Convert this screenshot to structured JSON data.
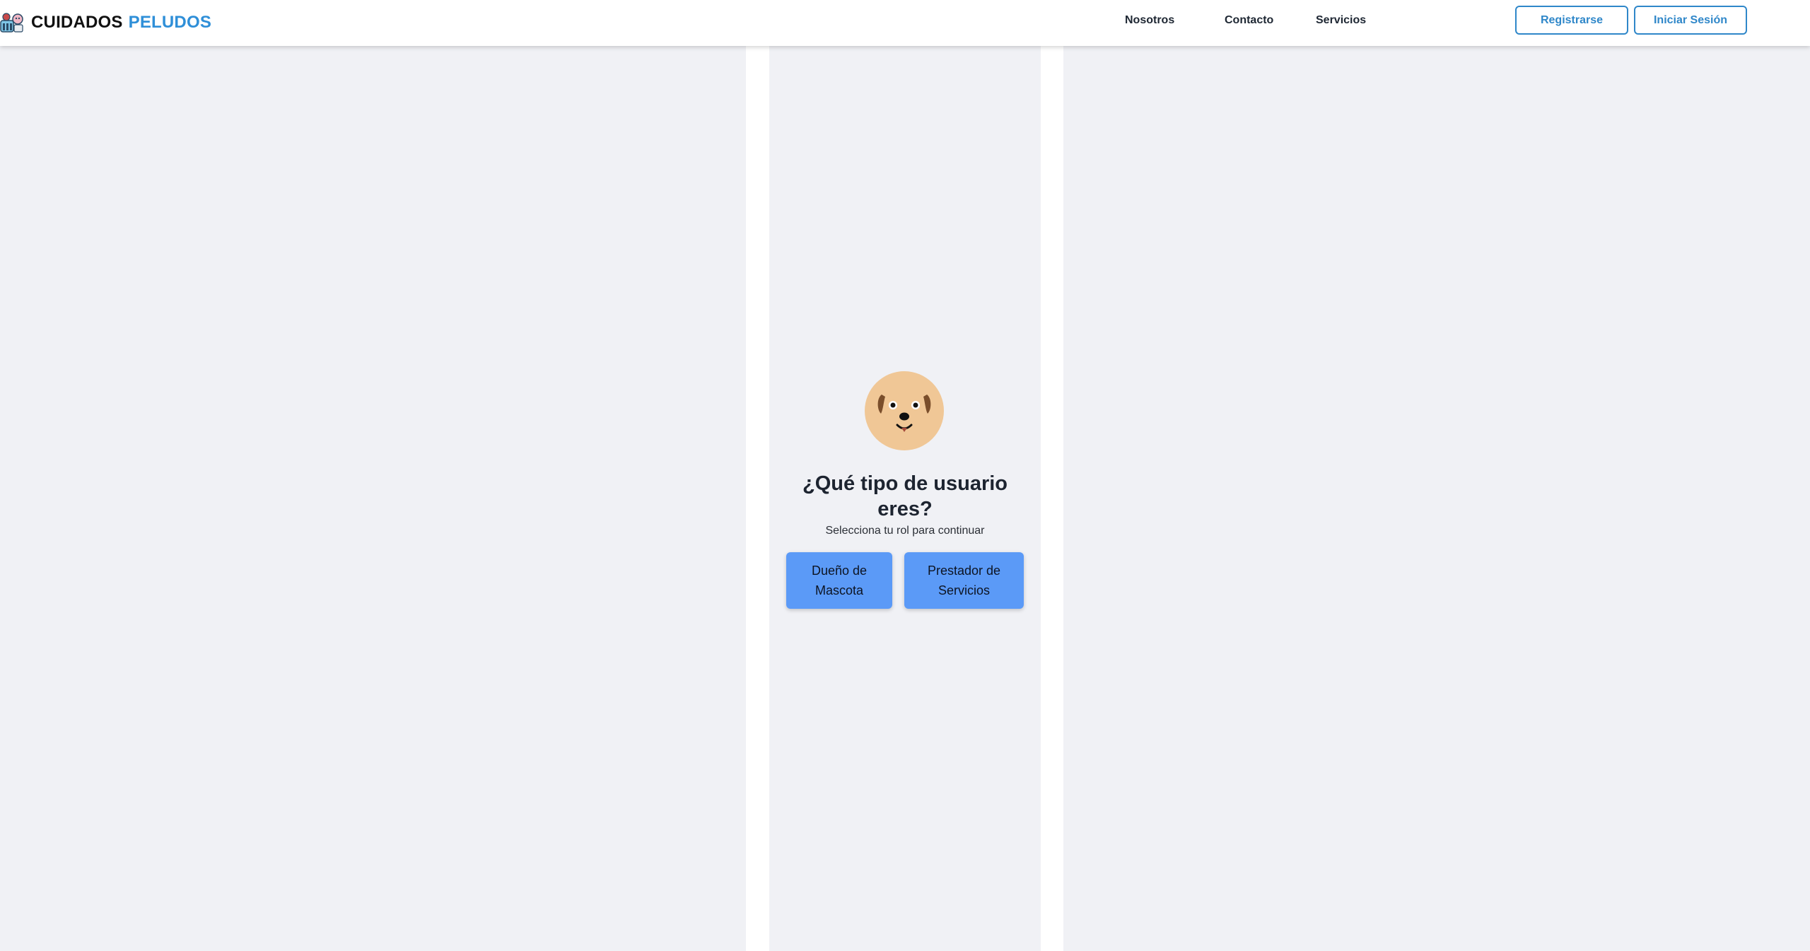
{
  "brand": {
    "name_part1": "CUIDADOS",
    "name_part2": "PELUDOS",
    "accent_color": "#2f8fd8",
    "logo_icon": "pets-logo-icon"
  },
  "nav": {
    "links": [
      {
        "label": "Nosotros"
      },
      {
        "label": "Contacto"
      },
      {
        "label": "Servicios"
      }
    ]
  },
  "auth": {
    "register_label": "Registrarse",
    "login_label": "Iniciar Sesión"
  },
  "role_selection": {
    "avatar_icon": "dog-face-icon",
    "title": "¿Qué tipo de usuario eres?",
    "subtitle": "Selecciona tu rol para continuar",
    "options": [
      {
        "label": "Dueño de Mascota"
      },
      {
        "label": "Prestador de Servicios"
      }
    ],
    "button_color": "#5b9af7"
  }
}
